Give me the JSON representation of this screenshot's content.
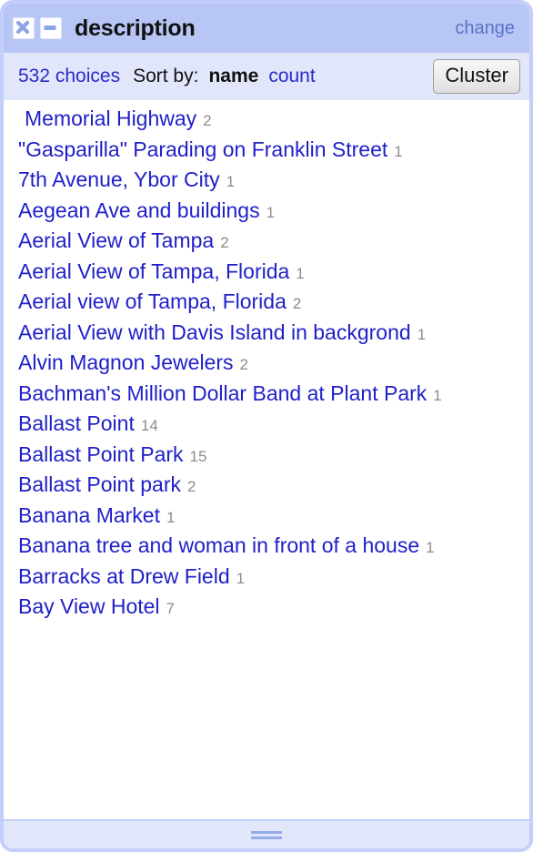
{
  "window": {
    "title": "description",
    "close_icon": "close-icon",
    "minimize_icon": "minimize-icon",
    "change_label": "change"
  },
  "toolbar": {
    "choices_label": "532 choices",
    "choices_count": 532,
    "sort_by_label": "Sort by:",
    "sort_options": [
      {
        "label": "name",
        "selected": true
      },
      {
        "label": "count",
        "selected": false
      }
    ],
    "cluster_label": "Cluster"
  },
  "colors": {
    "titlebar_bg": "#b7c6f5",
    "toolbar_bg": "#e2e6fb",
    "window_border": "#c3cffa",
    "link_blue": "#2020c8",
    "change_link": "#5a73c8",
    "count_gray": "#8c8c8c",
    "body_bg": "#ffffff"
  },
  "facets": [
    {
      "name": "Memorial Highway",
      "count": "2",
      "indented": true
    },
    {
      "name": "\"Gasparilla\" Parading on Franklin Street",
      "count": "1",
      "indented": false
    },
    {
      "name": "7th Avenue, Ybor City",
      "count": "1",
      "indented": false
    },
    {
      "name": "Aegean Ave and buildings",
      "count": "1",
      "indented": false
    },
    {
      "name": "Aerial View of Tampa",
      "count": "2",
      "indented": false
    },
    {
      "name": "Aerial View of Tampa, Florida",
      "count": "1",
      "indented": false
    },
    {
      "name": "Aerial view of Tampa, Florida",
      "count": "2",
      "indented": false
    },
    {
      "name": "Aerial View with Davis Island in backgrond",
      "count": "1",
      "indented": false
    },
    {
      "name": "Alvin Magnon Jewelers",
      "count": "2",
      "indented": false
    },
    {
      "name": "Bachman's Million Dollar Band at Plant Park",
      "count": "1",
      "indented": false
    },
    {
      "name": "Ballast Point",
      "count": "14",
      "indented": false
    },
    {
      "name": "Ballast Point Park",
      "count": "15",
      "indented": false
    },
    {
      "name": "Ballast Point park",
      "count": "2",
      "indented": false
    },
    {
      "name": "Banana Market",
      "count": "1",
      "indented": false
    },
    {
      "name": "Banana tree and woman in front of a house",
      "count": "1",
      "indented": false
    },
    {
      "name": "Barracks at Drew Field",
      "count": "1",
      "indented": false
    },
    {
      "name": "Bay View Hotel",
      "count": "7",
      "indented": false
    }
  ],
  "footer": {
    "resize_grip_icon": "resize-grip-icon"
  }
}
